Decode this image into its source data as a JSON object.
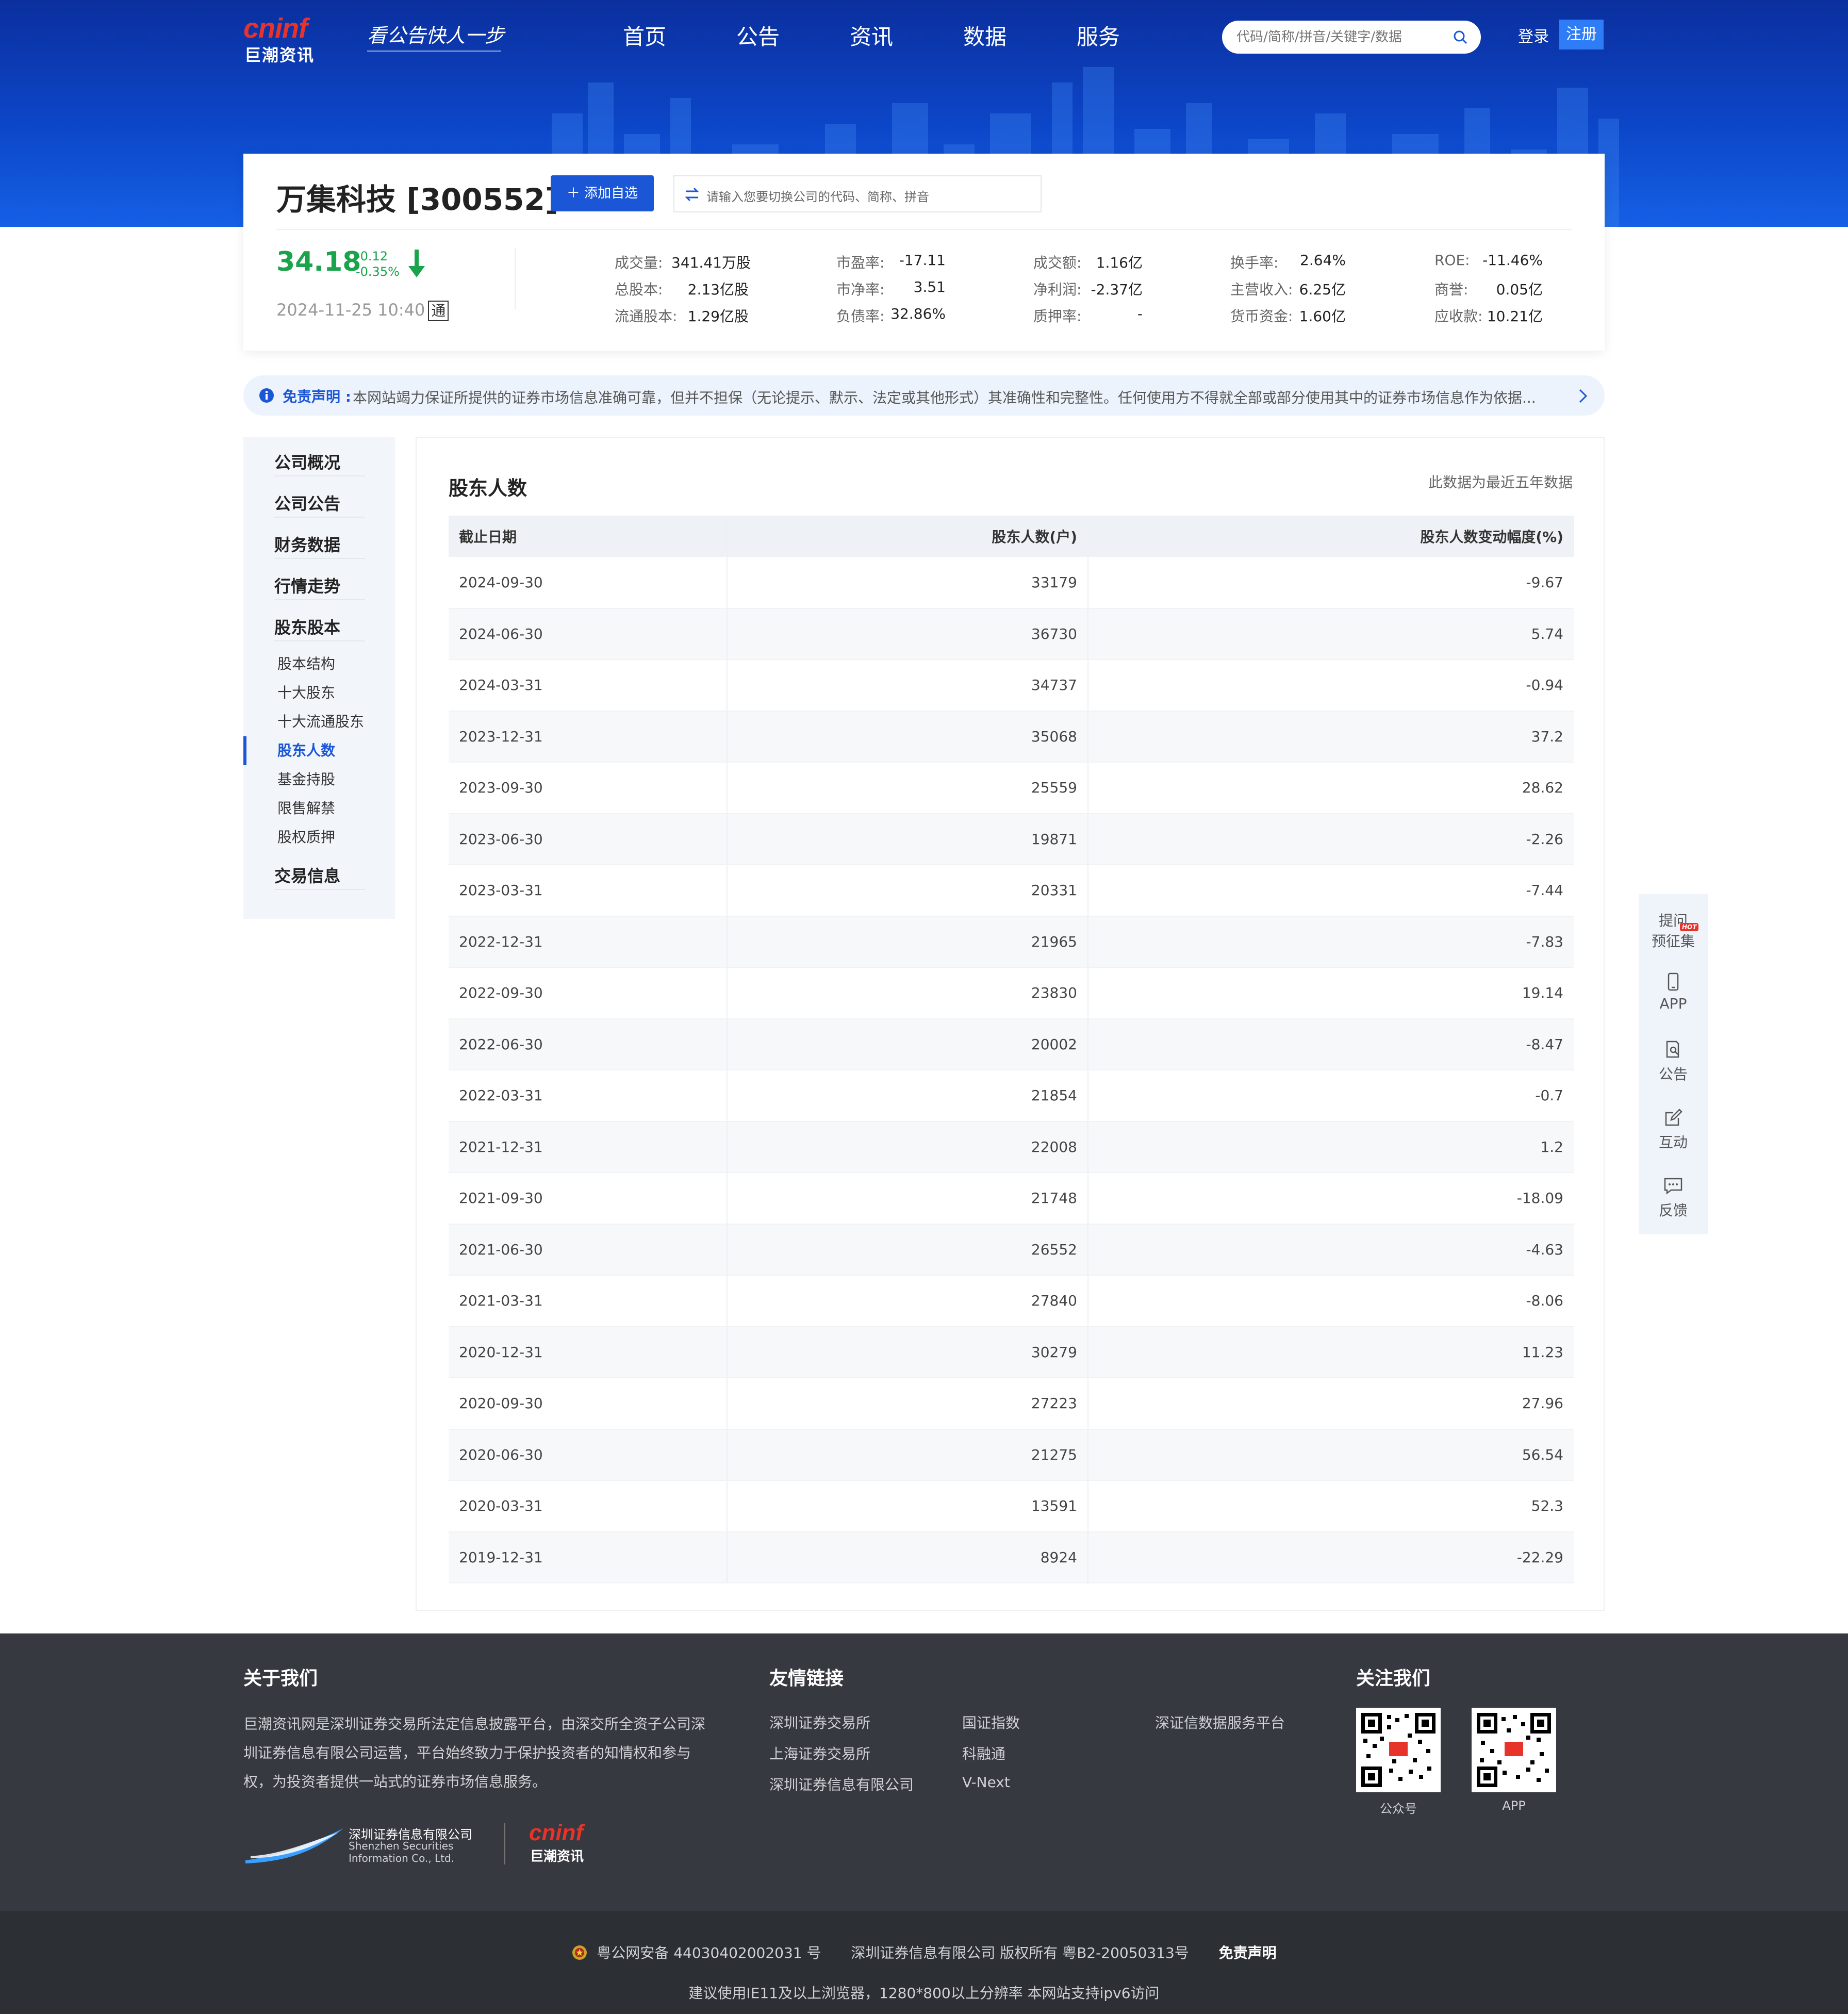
{
  "brand": {
    "logo_text": "cninf",
    "logo_cn": "巨潮资讯",
    "slogan": "看公告快人一步"
  },
  "nav": {
    "items": [
      "首页",
      "公告",
      "资讯",
      "数据",
      "服务"
    ]
  },
  "search": {
    "placeholder": "代码/简称/拼音/关键字/数据"
  },
  "auth": {
    "login": "登录",
    "register": "注册"
  },
  "company": {
    "name": "万集科技 [300552]",
    "add_label": "添加自选",
    "switch_placeholder": "请输入您要切换公司的代码、简称、拼音",
    "price": "34.18",
    "change": "-0.12",
    "change_pct": "-0.35%",
    "timestamp": "2024-11-25 10:40",
    "tong": "通"
  },
  "stats": [
    {
      "label": "成交量:",
      "value": "341.41万股"
    },
    {
      "label": "总股本:",
      "value": "2.13亿股"
    },
    {
      "label": "流通股本:",
      "value": "1.29亿股"
    },
    {
      "label": "市盈率:",
      "value": "-17.11"
    },
    {
      "label": "市净率:",
      "value": "3.51"
    },
    {
      "label": "负债率:",
      "value": "32.86%"
    },
    {
      "label": "成交额:",
      "value": "1.16亿"
    },
    {
      "label": "净利润:",
      "value": "-2.37亿"
    },
    {
      "label": "质押率:",
      "value": "-"
    },
    {
      "label": "换手率:",
      "value": "2.64%"
    },
    {
      "label": "主营收入:",
      "value": "6.25亿"
    },
    {
      "label": "货币资金:",
      "value": "1.60亿"
    },
    {
      "label": "ROE:",
      "value": "-11.46%"
    },
    {
      "label": "商誉:",
      "value": "0.05亿"
    },
    {
      "label": "应收款:",
      "value": "10.21亿"
    }
  ],
  "notice": {
    "title": "免责声明 :",
    "text": "本网站竭力保证所提供的证券市场信息准确可靠，但并不担保（无论提示、默示、法定或其他形式）其准确性和完整性。任何使用方不得就全部或部分使用其中的证券市场信息作为依据..."
  },
  "sidebar": {
    "main": [
      "公司概况",
      "公司公告",
      "财务数据",
      "行情走势",
      "股东股本",
      "交易信息"
    ],
    "sub": [
      "股本结构",
      "十大股东",
      "十大流通股东",
      "股东人数",
      "基金持股",
      "限售解禁",
      "股权质押"
    ]
  },
  "main": {
    "title": "股东人数",
    "note": "此数据为最近五年数据",
    "columns": [
      "截止日期",
      "股东人数(户)",
      "股东人数变动幅度(%)"
    ],
    "rows": [
      [
        "2024-09-30",
        "33179",
        "-9.67"
      ],
      [
        "2024-06-30",
        "36730",
        "5.74"
      ],
      [
        "2024-03-31",
        "34737",
        "-0.94"
      ],
      [
        "2023-12-31",
        "35068",
        "37.2"
      ],
      [
        "2023-09-30",
        "25559",
        "28.62"
      ],
      [
        "2023-06-30",
        "19871",
        "-2.26"
      ],
      [
        "2023-03-31",
        "20331",
        "-7.44"
      ],
      [
        "2022-12-31",
        "21965",
        "-7.83"
      ],
      [
        "2022-09-30",
        "23830",
        "19.14"
      ],
      [
        "2022-06-30",
        "20002",
        "-8.47"
      ],
      [
        "2022-03-31",
        "21854",
        "-0.7"
      ],
      [
        "2021-12-31",
        "22008",
        "1.2"
      ],
      [
        "2021-09-30",
        "21748",
        "-18.09"
      ],
      [
        "2021-06-30",
        "26552",
        "-4.63"
      ],
      [
        "2021-03-31",
        "27840",
        "-8.06"
      ],
      [
        "2020-12-31",
        "30279",
        "11.23"
      ],
      [
        "2020-09-30",
        "27223",
        "27.96"
      ],
      [
        "2020-06-30",
        "21275",
        "56.54"
      ],
      [
        "2020-03-31",
        "13591",
        "52.3"
      ],
      [
        "2019-12-31",
        "8924",
        "-22.29"
      ]
    ]
  },
  "float_bar": {
    "hot": "HOT",
    "ask_line1": "提问",
    "ask_line2": "预征集",
    "items": [
      "APP",
      "公告",
      "互动",
      "反馈"
    ]
  },
  "footer": {
    "about_title": "关于我们",
    "about_text": "巨潮资讯网是深圳证券交易所法定信息披露平台，由深交所全资子公司深圳证券信息有限公司运营，平台始终致力于保护投资者的知情权和参与权，为投资者提供一站式的证券市场信息服务。",
    "links_title": "友情链接",
    "links": [
      "深圳证券交易所",
      "上海证券交易所",
      "深圳证券信息有限公司",
      "国证指数",
      "科融通",
      "V-Next",
      "深证信数据服务平台"
    ],
    "follow_title": "关注我们",
    "qr_captions": [
      "公众号",
      "APP"
    ],
    "sz_logo_cn": "深圳证券信息有限公司",
    "sz_logo_en1": "Shenzhen Securities",
    "sz_logo_en2": "Information Co., Ltd.",
    "logo_text": "cninf",
    "logo_cn": "巨潮资讯",
    "beian": "粤公网安备 44030402002031 号",
    "copyright": "深圳证券信息有限公司 版权所有 粤B2-20050313号",
    "disclaimer": "免责声明",
    "browser_tip": "建议使用IE11及以上浏览器，1280*800以上分辨率 本网站支持ipv6访问"
  },
  "colors": {
    "brand_red": "#e8332b",
    "primary_blue": "#1a56d6",
    "fall_green": "#1aa34a",
    "footer_bg": "#36393f"
  }
}
